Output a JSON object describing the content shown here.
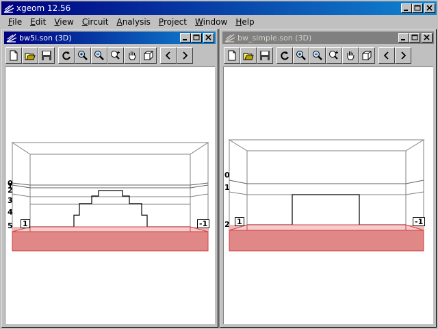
{
  "app": {
    "title": "xgeom 12.56"
  },
  "menu": [
    {
      "u": "F",
      "rest": "ile"
    },
    {
      "u": "E",
      "rest": "dit"
    },
    {
      "u": "V",
      "rest": "iew"
    },
    {
      "u": "C",
      "rest": "ircuit"
    },
    {
      "u": "A",
      "rest": "nalysis"
    },
    {
      "u": "P",
      "rest": "roject"
    },
    {
      "u": "W",
      "rest": "indow"
    },
    {
      "u": "H",
      "rest": "elp"
    }
  ],
  "windows": {
    "left": {
      "title": "bw5i.son (3D)",
      "levels": [
        "0",
        "1",
        "2",
        "3",
        "4",
        "5"
      ],
      "ports": [
        "1",
        "-1"
      ]
    },
    "right": {
      "title": "bw_simple.son (3D)",
      "levels": [
        "0",
        "1",
        "2"
      ],
      "ports": [
        "1",
        "-1"
      ]
    }
  },
  "toolbar_icons": [
    "new-file-icon",
    "open-folder-icon",
    "save-icon",
    "refresh-icon",
    "zoom-in-icon",
    "zoom-out-icon",
    "zoom-fit-icon",
    "pan-hand-icon",
    "3d-box-icon",
    "prev-arrow-icon",
    "next-arrow-icon"
  ],
  "colors": {
    "title_active": "#000080",
    "title_inactive": "#808080",
    "dielectric_fill": "#e8a0a0",
    "dielectric_edge": "#d04040"
  }
}
